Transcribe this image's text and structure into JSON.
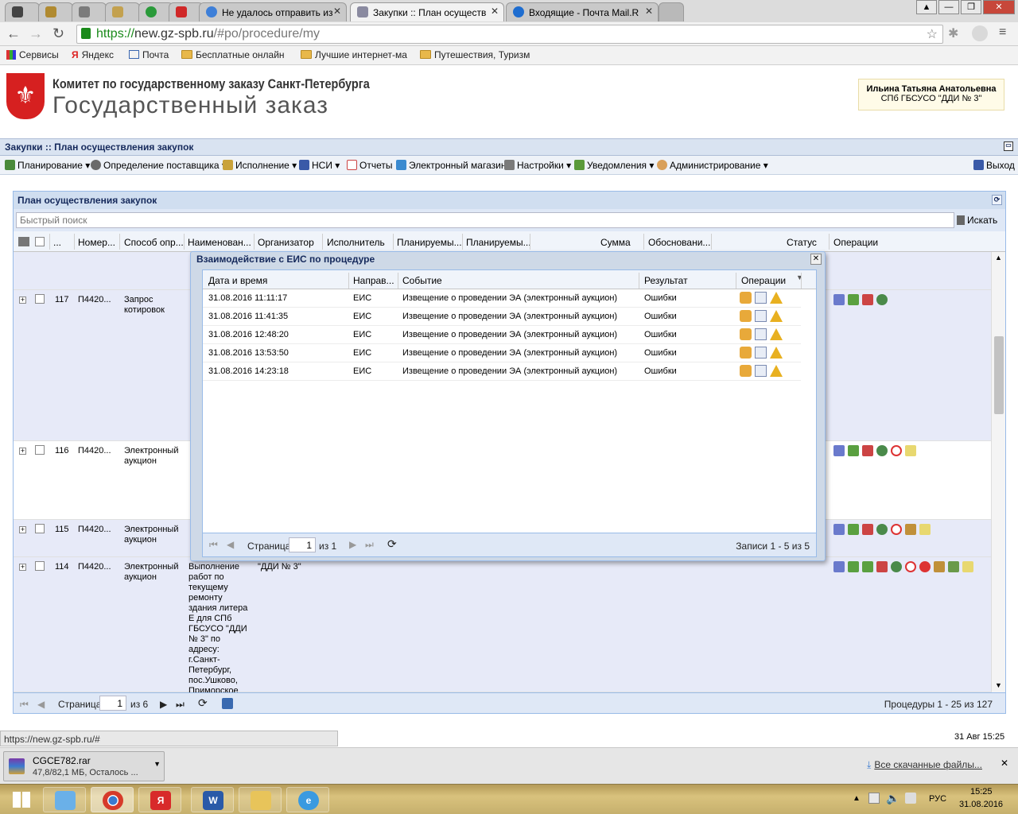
{
  "browser": {
    "tabs": [
      {
        "label": "Не удалось отправить из"
      },
      {
        "label": "Закупки :: План осуществ"
      },
      {
        "label": "Входящие - Почта Mail.R"
      }
    ],
    "url_scheme": "https://",
    "url_host": "new.gz-spb.ru",
    "url_path": "/#po/procedure/my",
    "bookmarks": [
      "Сервисы",
      "Яндекс",
      "Почта",
      "Бесплатные онлайн",
      "Лучшие интернет-ма",
      "Путешествия, Туризм"
    ]
  },
  "header": {
    "org_line1": "Комитет по государственному заказу Санкт-Петербурга",
    "org_line2": "Государственный заказ",
    "user_name": "Ильина Татьяна Анатольевна",
    "user_org": "СПб ГБСУСО \"ДДИ № 3\""
  },
  "titlebar": {
    "title": "Закупки :: План осуществления закупок"
  },
  "menu": {
    "items": [
      "Планирование",
      "Определение поставщика",
      "Исполнение",
      "НСИ",
      "Отчеты",
      "Электронный магазин",
      "Настройки",
      "Уведомления",
      "Администрирование"
    ],
    "exit": "Выход"
  },
  "panel": {
    "title": "План осуществления закупок",
    "search_placeholder": "Быстрый поиск",
    "search_button": "Искать",
    "columns": [
      "...",
      "Номер...",
      "Способ опр...",
      "Наименован...",
      "Организатор",
      "Исполнитель",
      "Планируемы...",
      "Планируемы...",
      "Сумма",
      "Обосновани...",
      "Статус",
      "Операции"
    ],
    "rows": [
      {
        "n": "117",
        "num": "П4420...",
        "method": "Запрос котировок"
      },
      {
        "n": "116",
        "num": "П4420...",
        "method": "Электронный аукцион"
      },
      {
        "n": "115",
        "num": "П4420...",
        "method": "Электронный аукцион"
      },
      {
        "n": "114",
        "num": "П4420...",
        "method": "Электронный аукцион",
        "org": "\"ДДИ № 3\"",
        "name": "Выполнение работ по текущему ремонту здания литера Е для СПб ГБСУСО \"ДДИ № 3\" по адресу: г.Санкт-Петербург, пос.Ушково, Приморское"
      }
    ],
    "pager": {
      "page_label": "Страница",
      "page": "1",
      "of": "из 6",
      "summary": "Процедуры 1 - 25 из 127"
    }
  },
  "modal": {
    "title": "Взаимодействие с ЕИС по процедуре",
    "columns": [
      "Дата и время",
      "Направ...",
      "Событие",
      "Результат",
      "Операции"
    ],
    "rows": [
      {
        "dt": "31.08.2016 11:11:17",
        "dir": "ЕИС",
        "event": "Извещение о проведении ЭА (электронный аукцион)",
        "result": "Ошибки"
      },
      {
        "dt": "31.08.2016 11:41:35",
        "dir": "ЕИС",
        "event": "Извещение о проведении ЭА (электронный аукцион)",
        "result": "Ошибки"
      },
      {
        "dt": "31.08.2016 12:48:20",
        "dir": "ЕИС",
        "event": "Извещение о проведении ЭА (электронный аукцион)",
        "result": "Ошибки"
      },
      {
        "dt": "31.08.2016 13:53:50",
        "dir": "ЕИС",
        "event": "Извещение о проведении ЭА (электронный аукцион)",
        "result": "Ошибки"
      },
      {
        "dt": "31.08.2016 14:23:18",
        "dir": "ЕИС",
        "event": "Извещение о проведении ЭА (электронный аукцион)",
        "result": "Ошибки"
      }
    ],
    "pager": {
      "page_label": "Страница",
      "page": "1",
      "of": "из 1",
      "summary": "Записи 1 - 5 из 5"
    }
  },
  "status": {
    "url": "https://new.gz-spb.ru/#",
    "date": "31 Авг 15:25"
  },
  "download": {
    "file": "CGCE782.rar",
    "progress": "47,8/82,1 МБ, Осталось ...",
    "all_downloads": "Все скачанные файлы..."
  },
  "taskbar": {
    "lang": "РУС",
    "time": "15:25",
    "date": "31.08.2016"
  }
}
